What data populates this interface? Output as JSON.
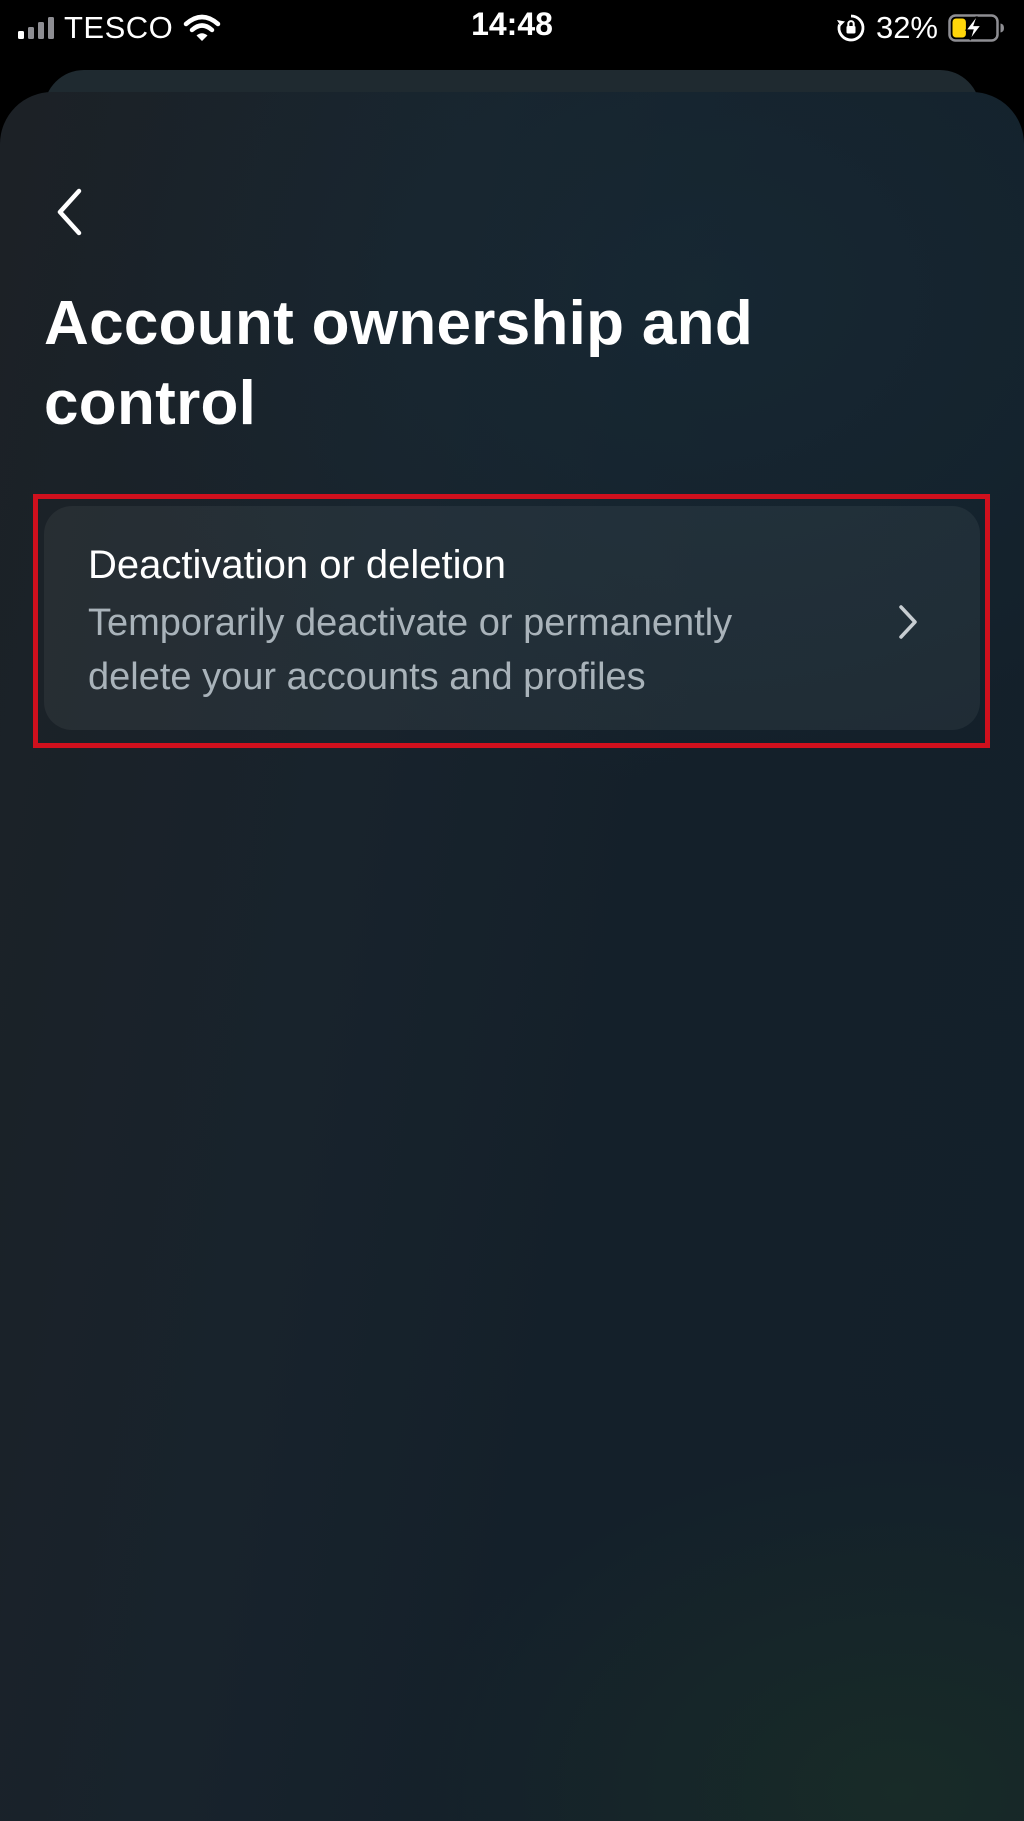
{
  "status_bar": {
    "carrier": "TESCO",
    "time": "14:48",
    "battery_percent": "32%",
    "signal_icon": "cellular-signal-icon",
    "wifi_icon": "wifi-icon",
    "rotation_lock_icon": "rotation-lock-icon",
    "battery_icon": "battery-charging-icon",
    "battery_level": 0.32
  },
  "header": {
    "back_icon": "chevron-left-icon",
    "title": "Account ownership and control"
  },
  "options": [
    {
      "title": "Deactivation or deletion",
      "description": "Temporarily deactivate or permanently delete your accounts and profiles",
      "icon": "chevron-right-icon"
    }
  ],
  "colors": {
    "background": "#141f28",
    "card": "#222c33",
    "title_text": "#ffffff",
    "secondary_text": "#a9b3ba",
    "highlight": "#d0101d",
    "battery_fill": "#ffd60a"
  }
}
